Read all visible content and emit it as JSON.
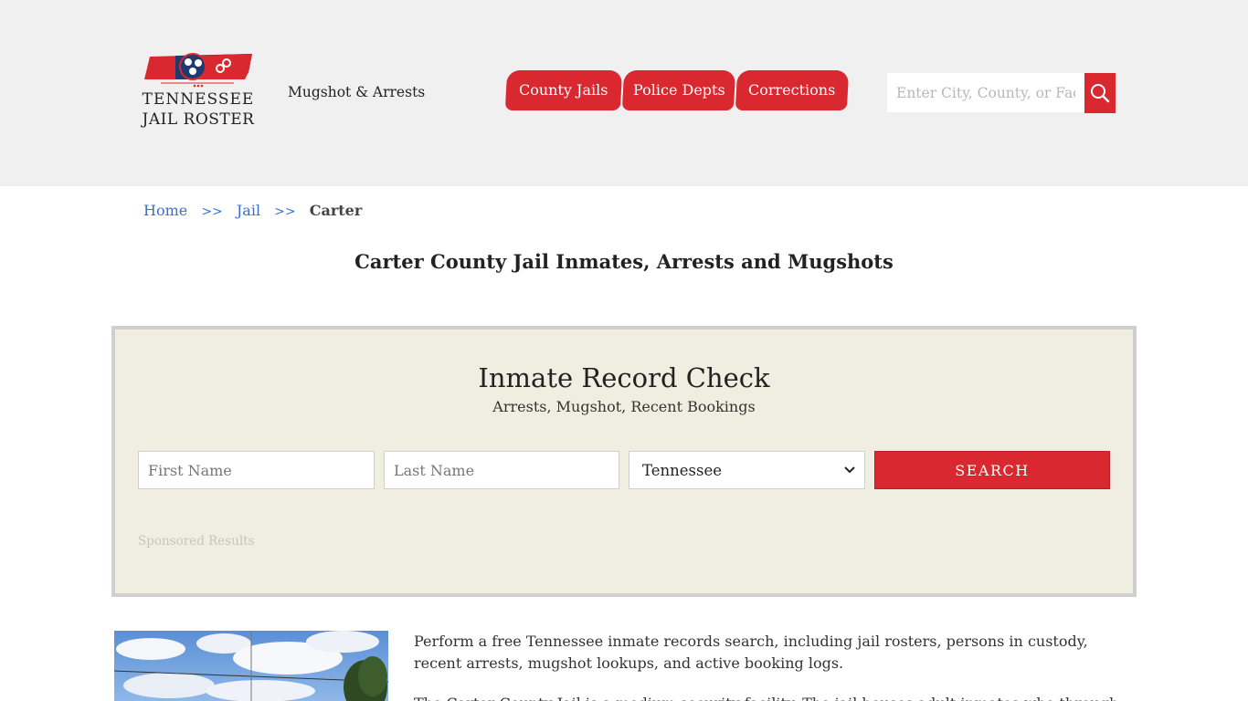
{
  "header": {
    "logo_line1": "TENNESSEE",
    "logo_line2": "JAIL ROSTER",
    "tagline": "Mugshot & Arrests",
    "nav": [
      {
        "label": "County Jails"
      },
      {
        "label": "Police Depts"
      },
      {
        "label": "Corrections"
      }
    ],
    "search_placeholder": "Enter City, County, or Facility",
    "search_icon": "search-icon"
  },
  "breadcrumb": {
    "home": "Home",
    "sep": ">>",
    "jail": "Jail",
    "current": "Carter"
  },
  "page_title": "Carter County Jail Inmates, Arrests and Mugshots",
  "record_check": {
    "title": "Inmate Record Check",
    "subtitle": "Arrests, Mugshot, Recent Bookings",
    "first_name_placeholder": "First Name",
    "last_name_placeholder": "Last Name",
    "state_selected": "Tennessee",
    "search_label": "SEARCH",
    "sponsored": "Sponsored Results"
  },
  "content": {
    "para1": "Perform a free Tennessee inmate records search, including jail rosters, persons in custody, recent arrests, mugshot lookups, and active booking logs.",
    "para2": "The Carter County Jail is a medium security facility. The jail houses adult inmates who through"
  },
  "colors": {
    "accent_red": "#d9282f",
    "header_bg": "#f0f0f0",
    "panel_bg": "#f0eee0",
    "link_blue": "#3a6fc7"
  }
}
